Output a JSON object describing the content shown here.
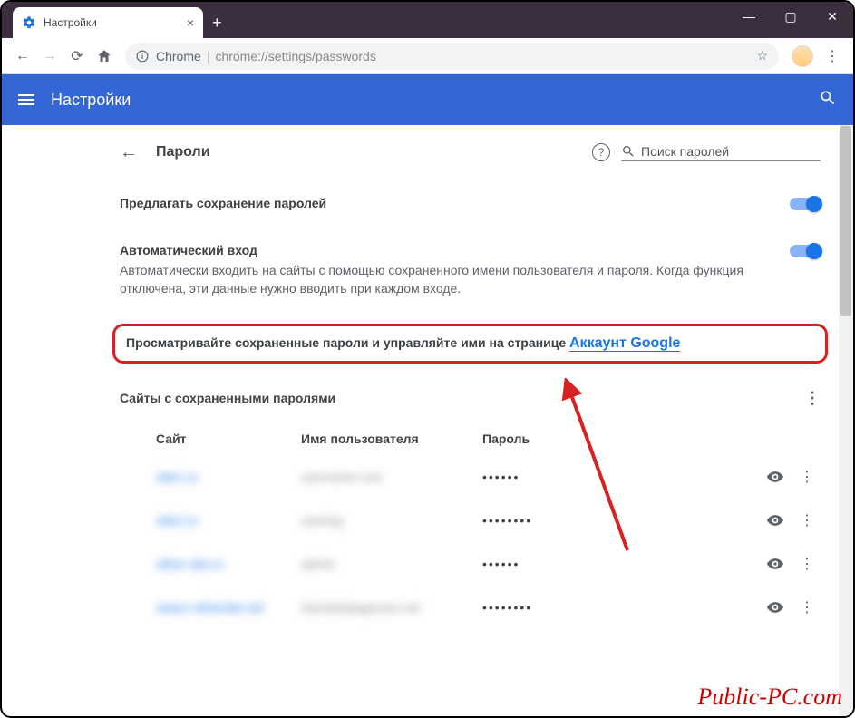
{
  "window": {
    "tab_title": "Настройки",
    "address_origin": "Chrome",
    "address_path": "chrome://settings/passwords"
  },
  "header": {
    "title": "Настройки"
  },
  "section": {
    "back_title": "Пароли",
    "search_placeholder": "Поиск паролей"
  },
  "offer_save": {
    "label": "Предлагать сохранение паролей"
  },
  "auto_signin": {
    "label": "Автоматический вход",
    "desc": "Автоматически входить на сайты с помощью сохраненного имени пользователя и пароля. Когда функция отключена, эти данные нужно вводить при каждом входе."
  },
  "highlight": {
    "text": "Просматривайте сохраненные пароли и управляйте ими на странице ",
    "link": "Аккаунт Google"
  },
  "table": {
    "title": "Сайты с сохраненными паролями",
    "col_site": "Сайт",
    "col_user": "Имя пользователя",
    "col_pass": "Пароль",
    "rows": [
      {
        "site": "site1.ru",
        "user": "username one",
        "pass": "••••••"
      },
      {
        "site": "site2.ru",
        "user": "userlog",
        "pass": "••••••••"
      },
      {
        "site": "other-site.ru",
        "user": "admin",
        "pass": "••••••"
      },
      {
        "site": "anacc-othersite.net",
        "user": "standartpageuser.net",
        "pass": "••••••••"
      }
    ]
  },
  "watermark": "Public-PC.com"
}
